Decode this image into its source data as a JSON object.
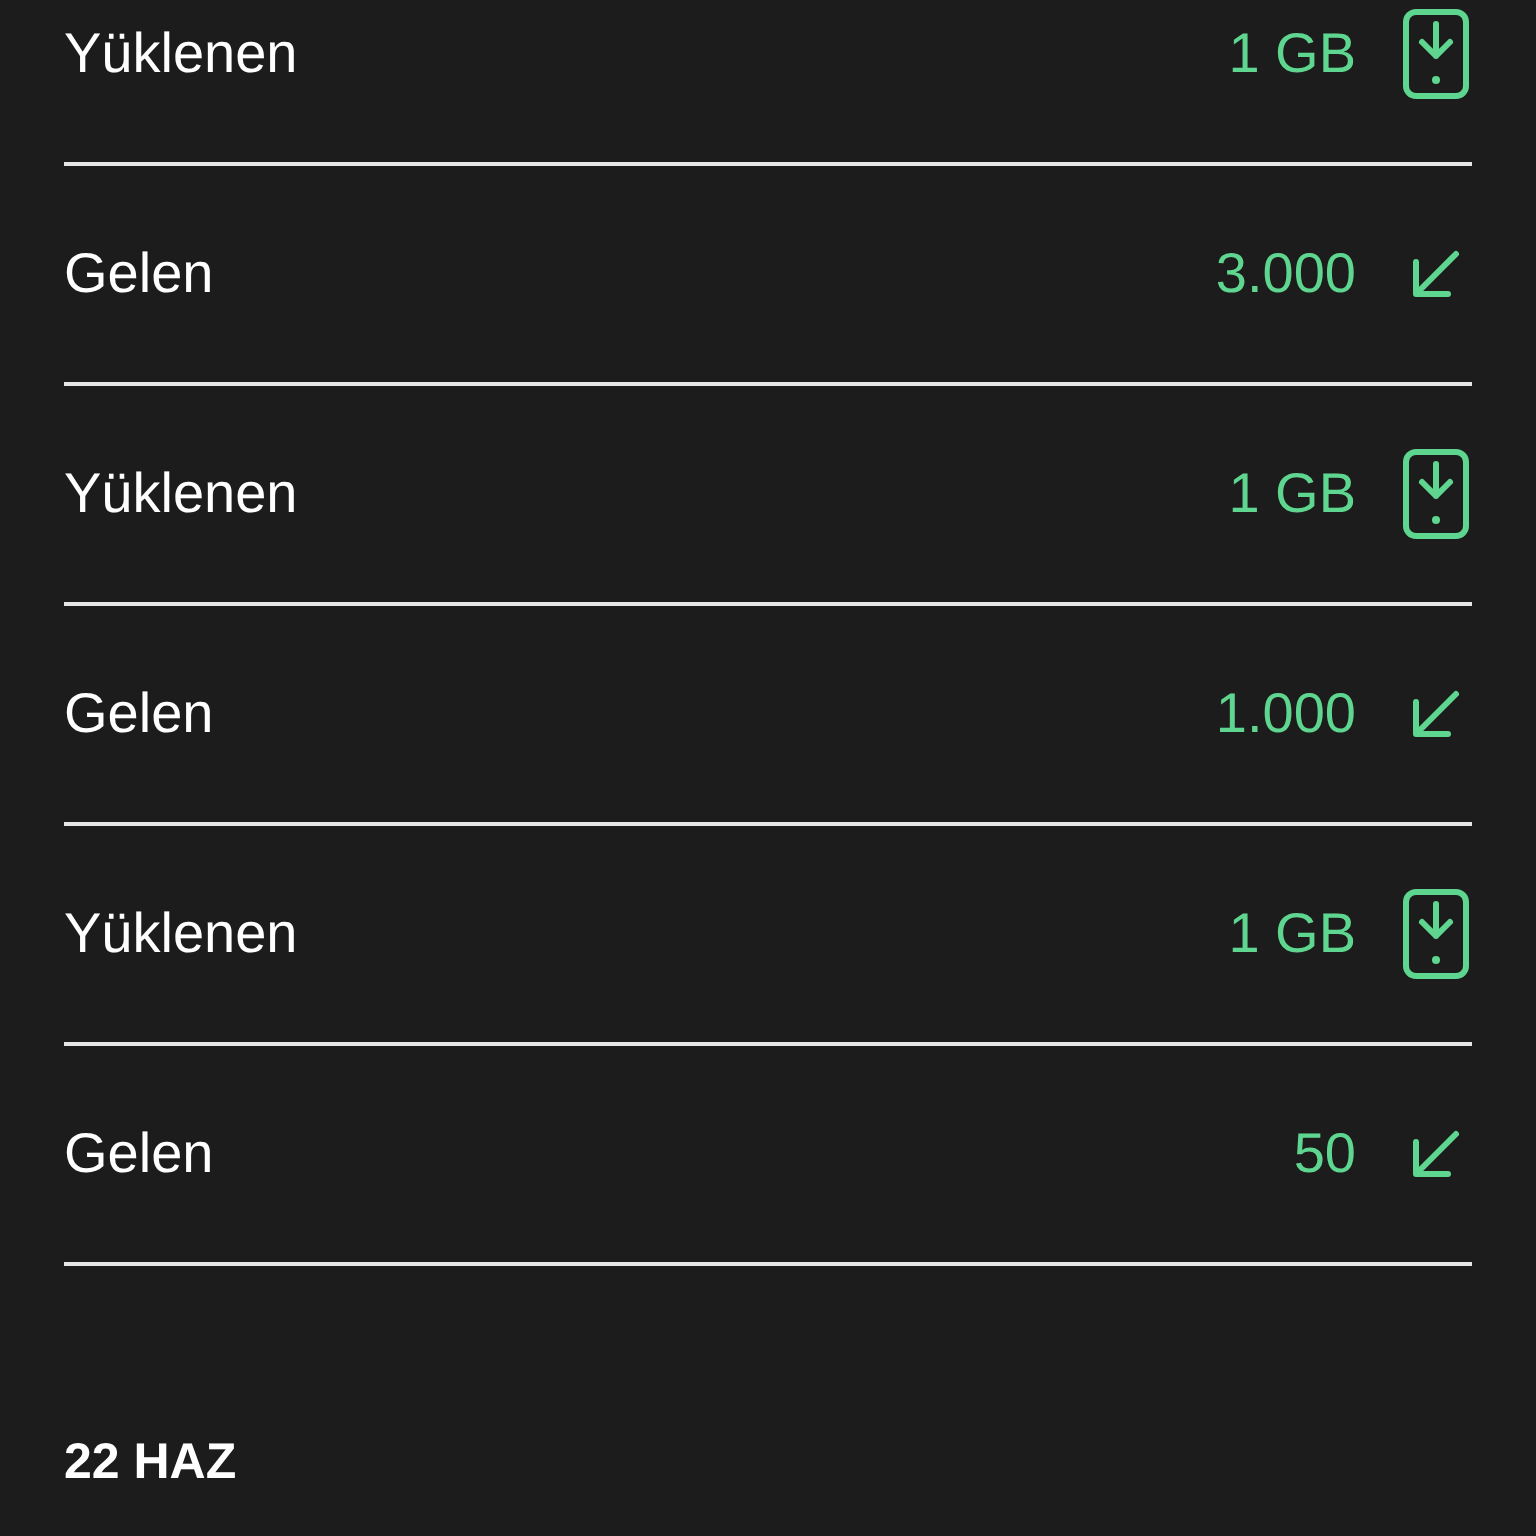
{
  "transactions": [
    {
      "label": "Yüklenen",
      "amount": "1 GB",
      "kind": "data"
    },
    {
      "label": "Gelen",
      "amount": "3.000",
      "kind": "incoming"
    },
    {
      "label": "Yüklenen",
      "amount": "1 GB",
      "kind": "data"
    },
    {
      "label": "Gelen",
      "amount": "1.000",
      "kind": "incoming"
    },
    {
      "label": "Yüklenen",
      "amount": "1 GB",
      "kind": "data"
    },
    {
      "label": "Gelen",
      "amount": "50",
      "kind": "incoming"
    }
  ],
  "date_header": "22 HAZ"
}
